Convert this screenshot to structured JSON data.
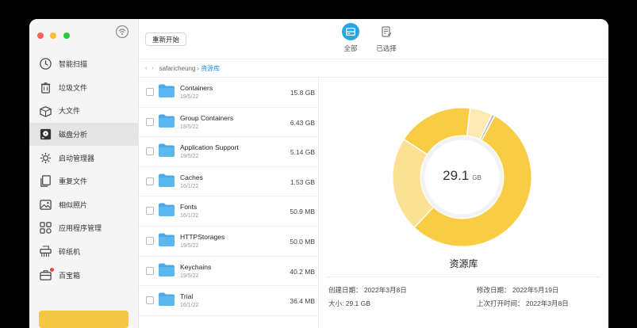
{
  "sidebar": {
    "items": [
      {
        "label": "智能扫描",
        "icon": "clock-scan-icon"
      },
      {
        "label": "垃圾文件",
        "icon": "trash-icon"
      },
      {
        "label": "大文件",
        "icon": "large-file-box-icon"
      },
      {
        "label": "磁盘分析",
        "icon": "disk-icon",
        "active": true
      },
      {
        "label": "启动管理器",
        "icon": "startup-gear-icon"
      },
      {
        "label": "重复文件",
        "icon": "duplicate-files-icon"
      },
      {
        "label": "相似照片",
        "icon": "photos-icon"
      },
      {
        "label": "应用程序管理",
        "icon": "apps-grid-icon"
      },
      {
        "label": "碎纸机",
        "icon": "shredder-icon"
      },
      {
        "label": "百宝箱",
        "icon": "toolbox-icon",
        "badge": true
      }
    ]
  },
  "toolbar": {
    "restart_label": "重新开始",
    "tabs": [
      {
        "label": "全部",
        "icon": "drive-icon",
        "active": true
      },
      {
        "label": "已选择",
        "icon": "selected-doc-icon"
      }
    ]
  },
  "breadcrumb": {
    "nav_arrows": "‹ ›",
    "parent": "safaricheung",
    "separator": "›",
    "current": "资源库"
  },
  "files": [
    {
      "name": "Containers",
      "date": "19/5/22",
      "size": "15.8 GB"
    },
    {
      "name": "Group Containers",
      "date": "18/5/22",
      "size": "6.43 GB"
    },
    {
      "name": "Application Support",
      "date": "19/5/22",
      "size": "5.14 GB"
    },
    {
      "name": "Caches",
      "date": "16/1/22",
      "size": "1.53 GB"
    },
    {
      "name": "Fonts",
      "date": "16/1/22",
      "size": "50.9 MB"
    },
    {
      "name": "HTTPStorages",
      "date": "19/5/22",
      "size": "50.0 MB"
    },
    {
      "name": "Keychains",
      "date": "19/5/22",
      "size": "40.2 MB"
    },
    {
      "name": "Trial",
      "date": "16/1/22",
      "size": "36.4 MB"
    }
  ],
  "detail": {
    "total_value": "29.1",
    "total_unit": "GB",
    "folder_name": "资源库",
    "created": "创建日期： 2022年3月8日",
    "modified": "修改日期： 2022年5月19日",
    "size": "大小: 29.1 GB",
    "last_opened": "上次打开时间： 2022年3月8日"
  },
  "colors": {
    "accent_blue": "#2aa6e3",
    "yellow": "#f8cd43",
    "light_yellow": "#fce093",
    "pale_yellow": "#fdeab3",
    "gray_slice": "#bcbcbc",
    "folder_blue": "#5bb8ee"
  },
  "chart_data": {
    "type": "pie",
    "categories": [
      "Containers",
      "Group Containers",
      "Application Support",
      "Caches",
      "Other"
    ],
    "values": [
      15.8,
      6.43,
      5.14,
      1.53,
      0.2
    ]
  }
}
